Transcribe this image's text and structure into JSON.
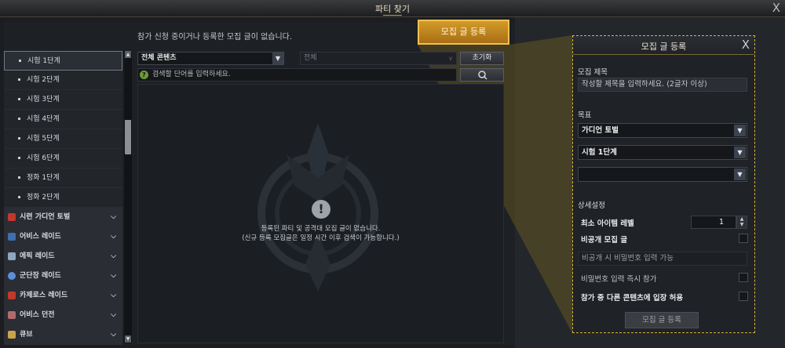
{
  "window": {
    "title": "파티 찾기",
    "close_glyph": "X"
  },
  "notice": "참가 신청 중이거나 등록한 모집 글이 없습니다.",
  "register_button": "모집 글 등록",
  "sidebar": {
    "subitems": [
      {
        "label": "시험 1단계",
        "selected": true
      },
      {
        "label": "시험 2단계"
      },
      {
        "label": "시험 3단계"
      },
      {
        "label": "시험 4단계"
      },
      {
        "label": "시험 5단계"
      },
      {
        "label": "시험 6단계"
      },
      {
        "label": "정화 1단계"
      },
      {
        "label": "정화 2단계"
      }
    ],
    "categories": [
      {
        "label": "시련 가디언 토벌",
        "icon": "red-guardian-icon",
        "color": "#c0392b"
      },
      {
        "label": "어비스 레이드",
        "icon": "blue-abyss-icon",
        "color": "#3e6fb0"
      },
      {
        "label": "에픽 레이드",
        "icon": "epic-raid-icon",
        "color": "#8fa6bf"
      },
      {
        "label": "군단장 레이드",
        "icon": "legion-icon",
        "color": "#5b8fd6"
      },
      {
        "label": "카제로스 레이드",
        "icon": "kazeros-icon",
        "color": "#c0392b"
      },
      {
        "label": "어비스 던전",
        "icon": "abyss-dungeon-icon",
        "color": "#b06a6a"
      },
      {
        "label": "큐브",
        "icon": "cube-icon",
        "color": "#c9a24a"
      }
    ]
  },
  "filters": {
    "content_select": "전체 콘텐츠",
    "sub_select": "전체",
    "reset_button": "초기화",
    "search_placeholder": "검색할 단어를 입력하세요.",
    "help_glyph": "?"
  },
  "empty_state": {
    "icon_glyph": "!",
    "line1": "등록된 파티 및 공격대 모집 글이 없습니다.",
    "line2": "(신규 등록 모집글은 일정 시간 이후 검색이 가능합니다.)"
  },
  "panel": {
    "title": "모집 글 등록",
    "close_glyph": "X",
    "title_label": "모집 제목",
    "title_placeholder": "작성할 제목을 입력하세요. (2글자 이상)",
    "goal_label": "목표",
    "goal_select1": "가디언 토벌",
    "goal_select2": "시험 1단계",
    "goal_select3": "",
    "detail_label": "상세설정",
    "min_level_label": "최소 아이템 레벨",
    "min_level_value": "1",
    "private_label": "비공개 모집 글",
    "password_placeholder": "비공개 시 비밀번호 입력 가능",
    "instant_join_label": "비밀번호 입력 즉시 참가",
    "allow_other_label": "참가 중 다른 콘텐츠에 입장 허용",
    "submit_button": "모집 글 등록"
  },
  "colors": {
    "accent": "#f1c14e",
    "highlight_border": "#d8b43a"
  }
}
